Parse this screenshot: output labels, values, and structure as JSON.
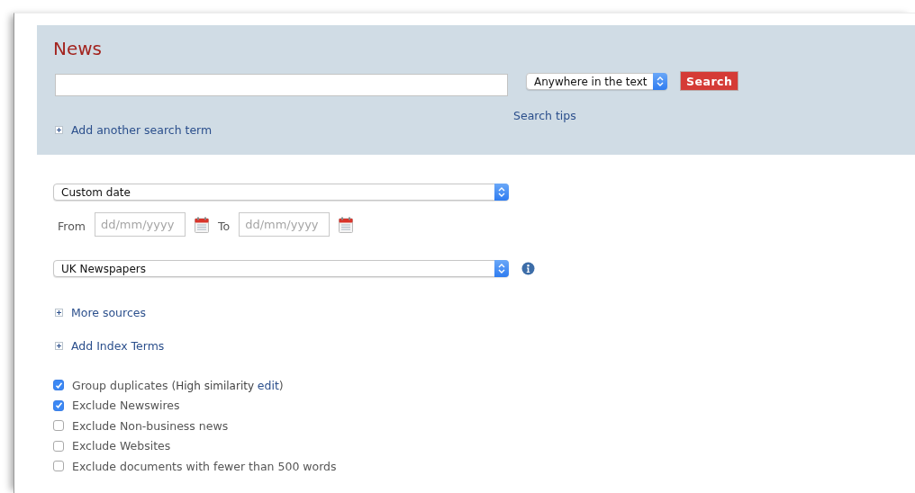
{
  "search_panel": {
    "title": "News",
    "scope_select": {
      "value": "Anywhere in the text"
    },
    "search_button": "Search",
    "search_tips": "Search tips",
    "add_term": "Add another search term"
  },
  "date": {
    "select": "Custom date",
    "from_label": "From",
    "from": {
      "placeholder": "dd/mm/yyyy"
    },
    "to_label": "To",
    "to": {
      "placeholder": "dd/mm/yyyy"
    }
  },
  "sources": {
    "select": "UK Newspapers"
  },
  "expanders": [
    "More sources",
    "Add Index Terms"
  ],
  "options": [
    {
      "label": "Group duplicates (",
      "detail": "High similarity",
      "link": "edit",
      "suffix": ")",
      "checked": true
    },
    {
      "label": "Exclude Newswires",
      "checked": true
    },
    {
      "label": "Exclude Non-business news",
      "checked": false
    },
    {
      "label": "Exclude Websites",
      "checked": false
    },
    {
      "label": "Exclude documents with fewer than 500 words",
      "checked": false
    }
  ]
}
